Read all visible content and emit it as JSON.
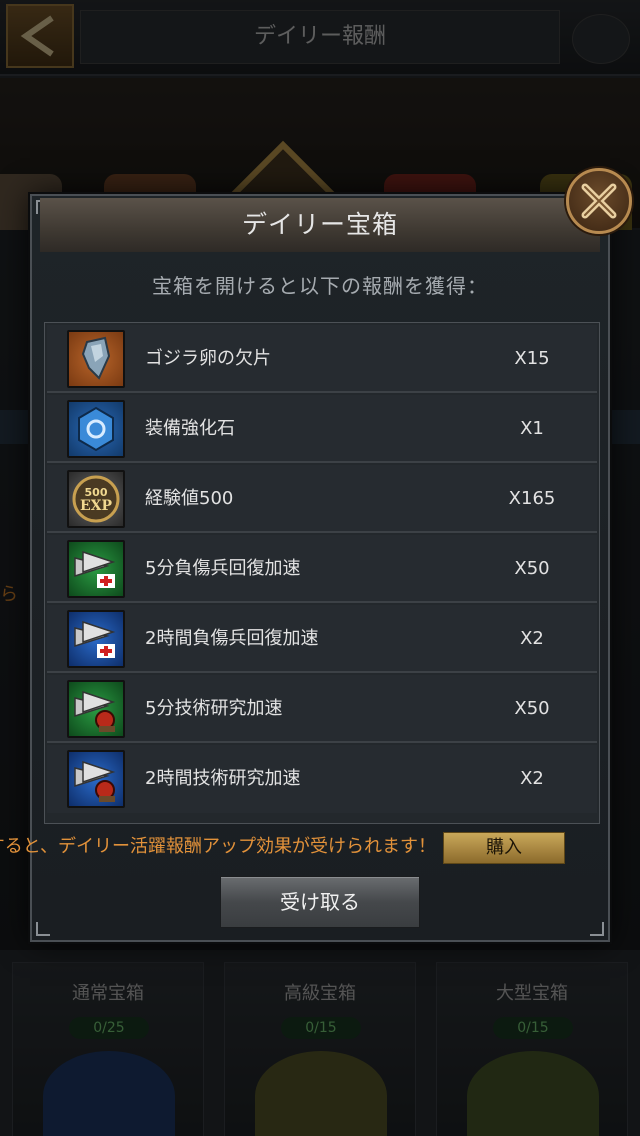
{
  "background": {
    "title": "デイリー報酬",
    "orange_fragment": "ら",
    "cards": [
      {
        "title": "通常宝箱",
        "count": "0/25"
      },
      {
        "title": "高級宝箱",
        "count": "0/15"
      },
      {
        "title": "大型宝箱",
        "count": "0/15"
      }
    ]
  },
  "dialog": {
    "title": "デイリー宝箱",
    "subtitle": "宝箱を開けると以下の報酬を獲得：",
    "rewards": [
      {
        "name": "ゴジラ卵の欠片",
        "qty": "X15",
        "icon": "godzilla-egg-fragment-icon"
      },
      {
        "name": "装備強化石",
        "qty": "X1",
        "icon": "enhancement-stone-icon"
      },
      {
        "name": "経験値500",
        "qty": "X165",
        "icon": "exp-500-icon",
        "icon_text_top": "500",
        "icon_text_bottom": "EXP"
      },
      {
        "name": "5分負傷兵回復加速",
        "qty": "X50",
        "icon": "heal-speedup-5m-icon"
      },
      {
        "name": "2時間負傷兵回復加速",
        "qty": "X2",
        "icon": "heal-speedup-2h-icon"
      },
      {
        "name": "5分技術研究加速",
        "qty": "X50",
        "icon": "research-speedup-5m-icon"
      },
      {
        "name": "2時間技術研究加速",
        "qty": "X2",
        "icon": "research-speedup-2h-icon"
      }
    ],
    "promo_text": "すると、デイリー活躍報酬アップ効果が受けられます！",
    "buy_label": "購入",
    "claim_label": "受け取る"
  },
  "colors": {
    "promo": "#e2923a",
    "buy_button": "#c9a85a",
    "speedup_green": "#1f7a32",
    "speedup_blue": "#1f4f8a"
  }
}
